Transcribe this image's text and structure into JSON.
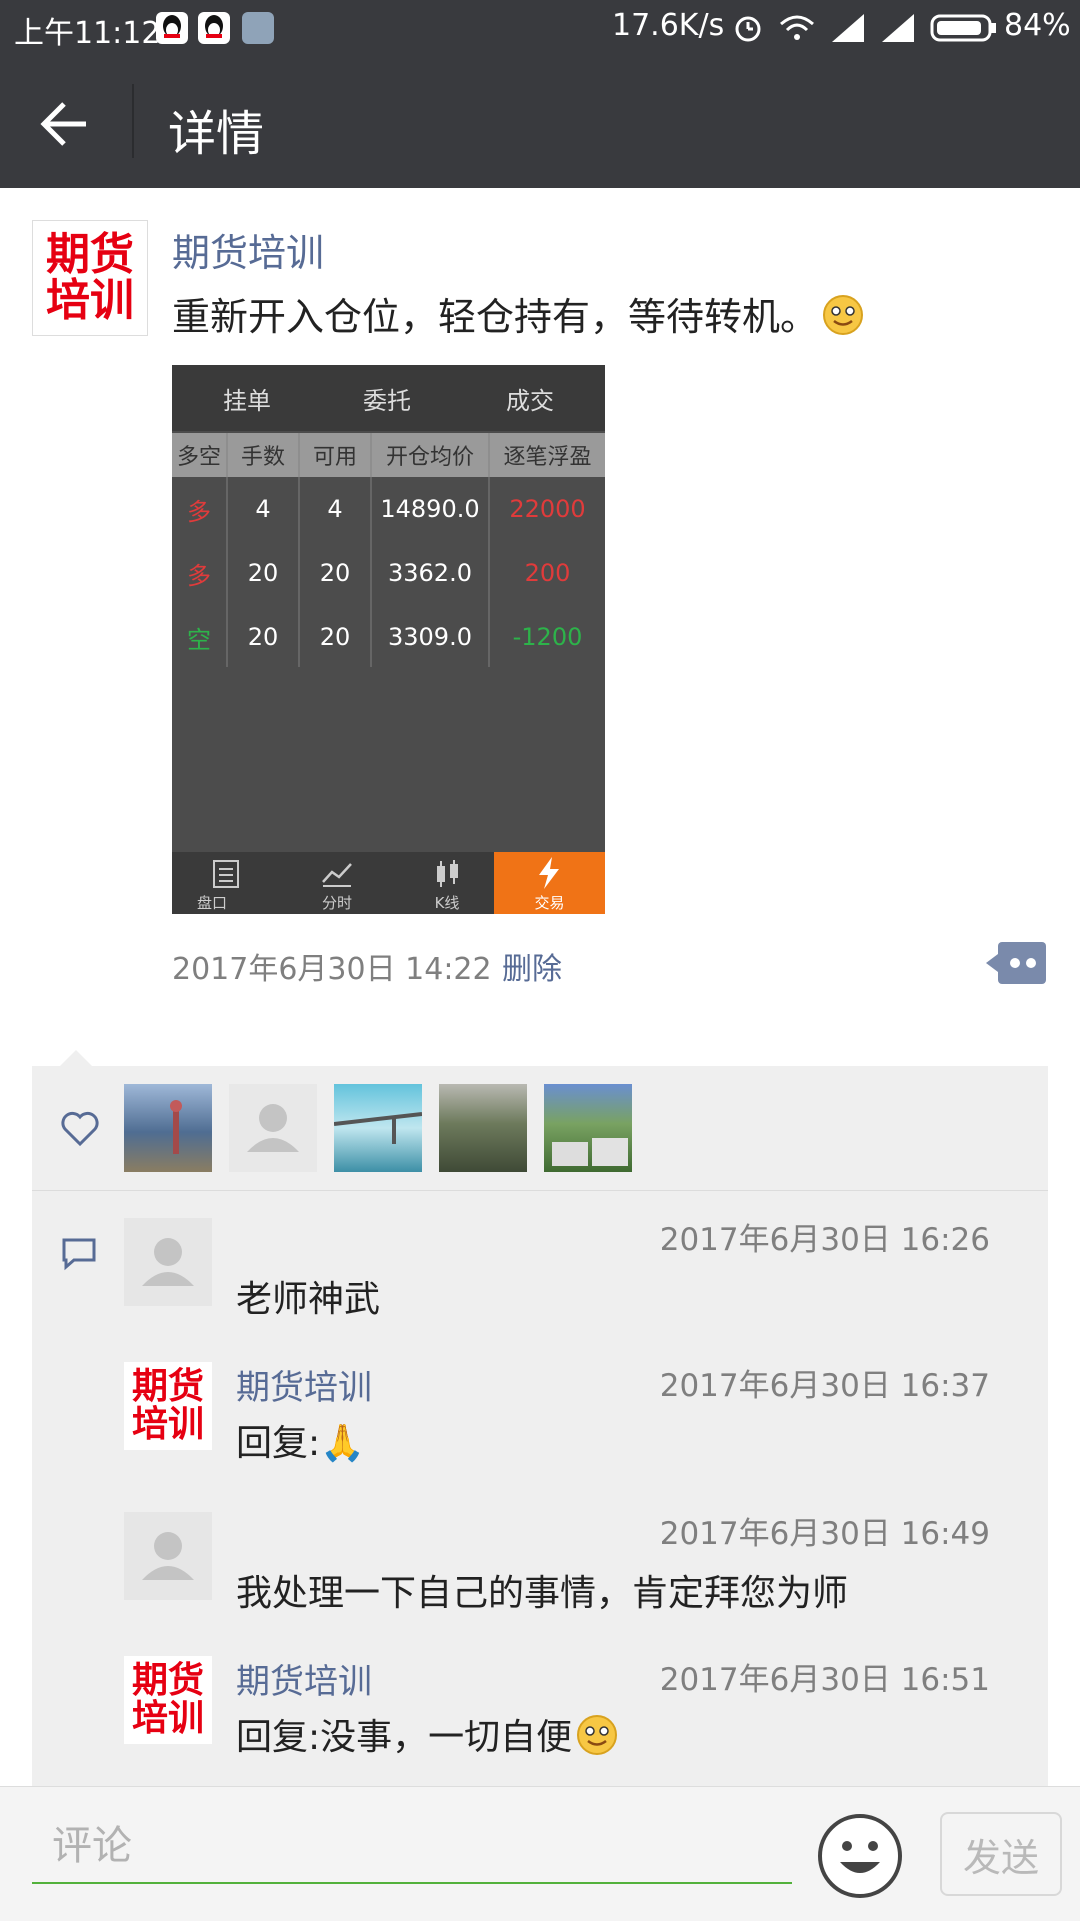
{
  "status_bar": {
    "time": "上午11:12",
    "speed": "17.6K/s",
    "battery": "84%"
  },
  "header": {
    "title": "详情"
  },
  "post": {
    "avatar_text": [
      "期货",
      "培训"
    ],
    "author": "期货培训",
    "text": "重新开入仓位，轻仓持有，等待转机。",
    "time": "2017年6月30日 14:22",
    "delete_label": "删除",
    "image": {
      "tabs": [
        "挂单",
        "委托",
        "成交"
      ],
      "columns": [
        "多空",
        "手数",
        "可用",
        "开仓均价",
        "逐笔浮盈"
      ],
      "rows": [
        {
          "dir": "多",
          "qty": "4",
          "avail": "4",
          "price": "14890.0",
          "pnl": "22000",
          "dir_color": "#e03b3b",
          "pnl_color": "#e03b3b"
        },
        {
          "dir": "多",
          "qty": "20",
          "avail": "20",
          "price": "3362.0",
          "pnl": "200",
          "dir_color": "#e03b3b",
          "pnl_color": "#e03b3b"
        },
        {
          "dir": "空",
          "qty": "20",
          "avail": "20",
          "price": "3309.0",
          "pnl": "-1200",
          "dir_color": "#2db34a",
          "pnl_color": "#2db34a"
        }
      ],
      "nav": [
        "盘口",
        "分时",
        "K线",
        "交易"
      ],
      "nav_active_color": "#f07316"
    }
  },
  "likes": {
    "count": 5
  },
  "comments": [
    {
      "author": "",
      "time": "2017年6月30日 16:26",
      "text": "老师神武"
    },
    {
      "author": "期货培训",
      "time": "2017年6月30日 16:37",
      "text": "回复:🙏"
    },
    {
      "author": "",
      "time": "2017年6月30日 16:49",
      "text": "我处理一下自己的事情，肯定拜您为师"
    },
    {
      "author": "期货培训",
      "time": "2017年6月30日 16:51",
      "text": "回复:没事，一切自便"
    }
  ],
  "input": {
    "placeholder": "评论",
    "send_label": "发送"
  },
  "colors": {
    "link": "#576b95",
    "bar": "#393a3e",
    "accent_green": "#52b13b"
  }
}
